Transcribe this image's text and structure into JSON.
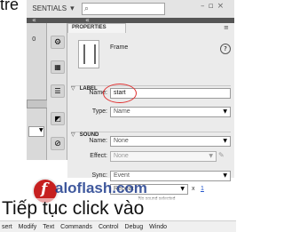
{
  "caption_top": "trè",
  "workspace": {
    "label": "SENTIALS",
    "dropdown_arrow": "▾",
    "search_placeholder": ""
  },
  "window_controls": {
    "minimize": "–",
    "maximize": "▫",
    "close": "×"
  },
  "panel": {
    "tab_label": "PROPERTIES",
    "collapse_glyph": "«",
    "frame_label": "Frame",
    "label_section": {
      "title": "LABEL",
      "name_label": "Name:",
      "name_value": "start",
      "type_label": "Type:",
      "type_value": "Name"
    },
    "sound_section": {
      "title": "SOUND",
      "name_label": "Name:",
      "name_value": "None",
      "effect_label": "Effect:",
      "effect_value": "None",
      "sync_label": "Sync:",
      "sync_value": "Event",
      "repeat_value": "Repeat",
      "repeat_count": "1",
      "repeat_x": "x",
      "status_text": "No sound selected"
    }
  },
  "left_panel": {
    "number": "0"
  },
  "watermark": {
    "logo_letter": "f",
    "text": "aloflash.com"
  },
  "caption_bottom": "Tiếp tục click vào",
  "menu_items": [
    "sert",
    "Modify",
    "Text",
    "Commands",
    "Control",
    "Debug",
    "Windo"
  ],
  "colors": {
    "highlight_circle": "#e03030",
    "panel_bg": "#ebebeb",
    "dark_bar": "#4a4a4a"
  }
}
